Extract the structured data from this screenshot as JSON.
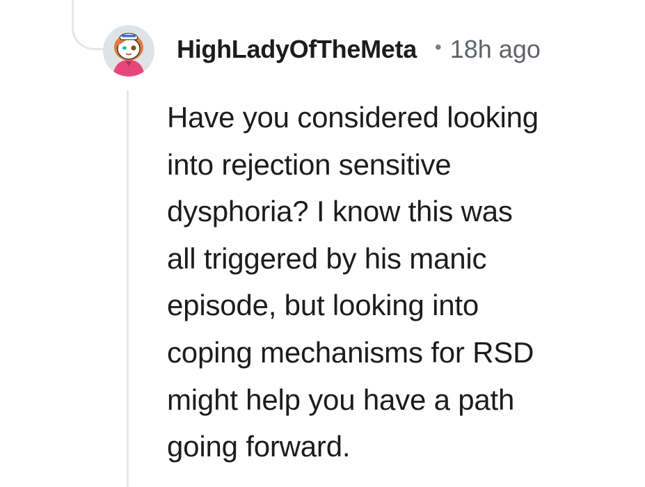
{
  "comment": {
    "username": "HighLadyOfTheMeta",
    "separator": "•",
    "timestamp": "18h ago",
    "body_lines": [
      "Have you considered looking",
      "into rejection sensitive",
      "dysphoria? I know this was",
      "all triggered by his manic",
      "episode, but looking into",
      "coping mechanisms for RSD",
      "might help you have a path",
      "going forward."
    ]
  },
  "colors": {
    "text": "#1c1c1c",
    "meta": "#5f6368",
    "thread_line": "#e4e6e8",
    "avatar_bg": "#dfe3e6",
    "avatar_shirt": "#e8457a",
    "avatar_hair": "#e07b3c"
  },
  "icons": {
    "avatar": "user-avatar-icon"
  }
}
